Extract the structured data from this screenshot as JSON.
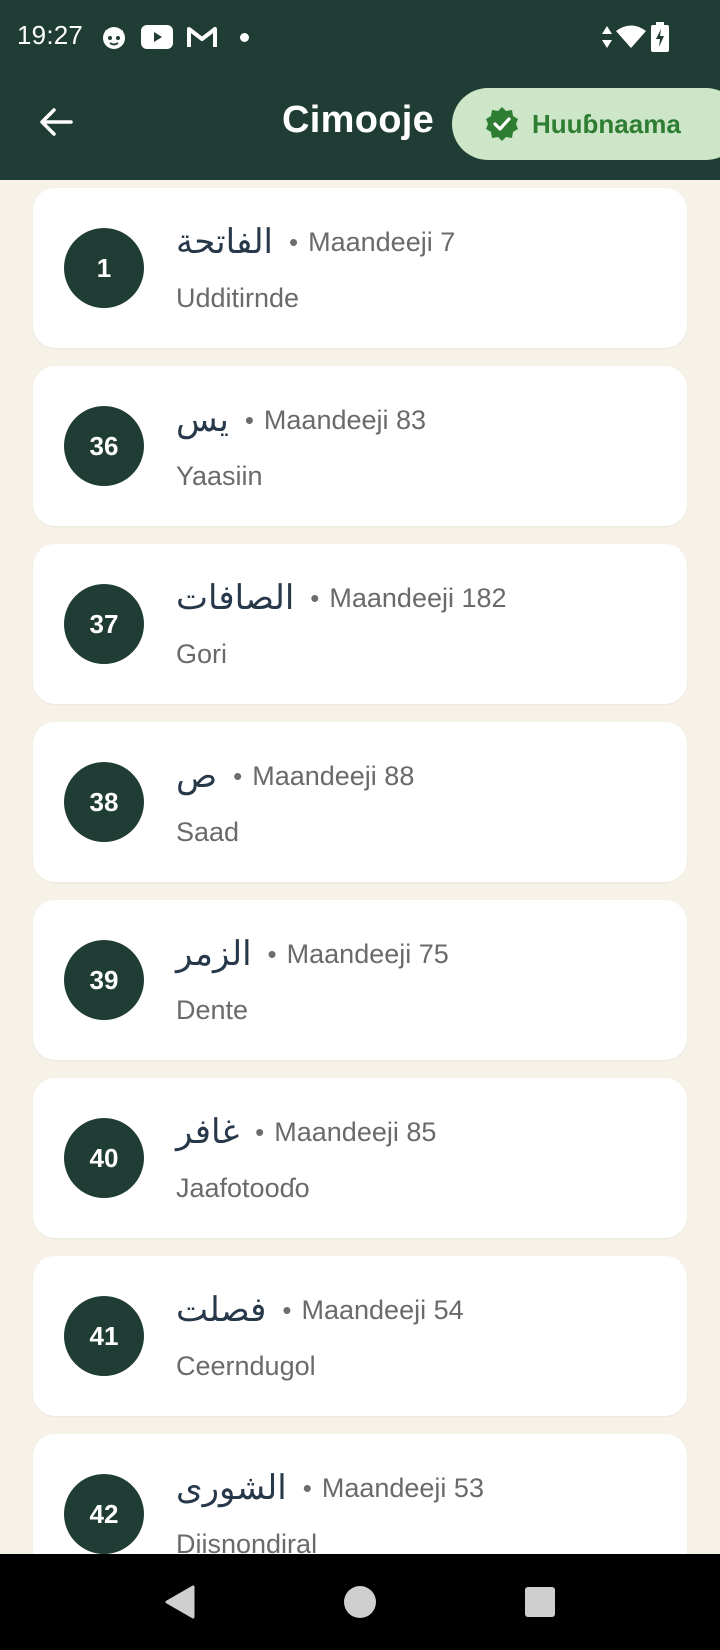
{
  "status_bar": {
    "time": "19:27",
    "icons": [
      "cat-notification-icon",
      "youtube-icon",
      "gmail-icon",
      "more-dot-icon",
      "data-arrows-icon",
      "wifi-icon",
      "battery-charging-icon"
    ]
  },
  "app_bar": {
    "title": "Cimooje",
    "back_icon": "arrow-back-icon",
    "chip": {
      "label": "Huuɓnaama",
      "icon": "verified-check-icon"
    }
  },
  "surahs": [
    {
      "number": "1",
      "arabic": "الفاتحة",
      "verses": "Maandeeji 7",
      "name": "Udditirnde"
    },
    {
      "number": "36",
      "arabic": "يس",
      "verses": "Maandeeji 83",
      "name": "Yaasiin"
    },
    {
      "number": "37",
      "arabic": "الصافات",
      "verses": "Maandeeji 182",
      "name": "Gori"
    },
    {
      "number": "38",
      "arabic": "ص",
      "verses": "Maandeeji 88",
      "name": "Saad"
    },
    {
      "number": "39",
      "arabic": "الزمر",
      "verses": "Maandeeji 75",
      "name": "Dente"
    },
    {
      "number": "40",
      "arabic": "غافر",
      "verses": "Maandeeji 85",
      "name": "Jaafotooɗo"
    },
    {
      "number": "41",
      "arabic": "فصلت",
      "verses": "Maandeeji 54",
      "name": "Ceerndugol"
    },
    {
      "number": "42",
      "arabic": "الشورى",
      "verses": "Maandeeji 53",
      "name": "Diisnondiral"
    }
  ],
  "separator": "•",
  "colors": {
    "header": "#1f3d34",
    "background": "#f6f2e8",
    "chip_bg": "#cde6c8",
    "chip_text": "#2e7d32"
  },
  "nav_bar": [
    "back-triangle-icon",
    "home-circle-icon",
    "recents-square-icon"
  ]
}
